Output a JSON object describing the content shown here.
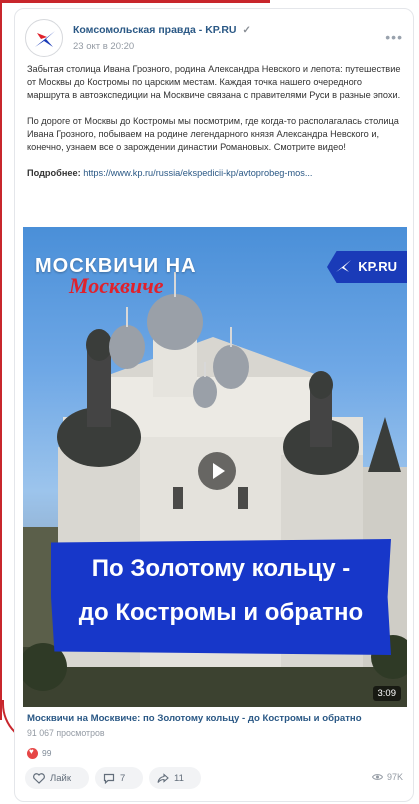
{
  "post": {
    "author": "Комсомольская правда - KP.RU",
    "verified": "✓",
    "date": "23 окт в 20:20",
    "paragraph1": "Забытая столица Ивана Грозного, родина Александра Невского и лепота: путешествие от Москвы до Костромы по царским местам. Каждая точка нашего очередного маршрута в автоэкспедиции на Москвиче связана с правителями Руси в разные эпохи.",
    "paragraph2": "По дороге от Москвы до Костромы мы посмотрим, где когда-то располагалась столица Ивана Грозного, побываем на родине легендарного князя Александра Невского и, конечно, узнаем все о зарождении династии Романовых. Смотрите видео!",
    "link_label": "Подробнее:",
    "link_url": "https://www.kp.ru/russia/ekspedicii-kp/avtoprobeg-mos..."
  },
  "video": {
    "brand_title": "МОСКВИЧИ НА",
    "brand_sub": "Москвиче",
    "kp_logo": "KP.RU",
    "banner_line1": "По Золотому кольцу -",
    "banner_line2": "до Костромы и обратно",
    "duration": "3:09",
    "title": "Москвичи на Москвиче: по Золотому кольцу - до Костромы и обратно",
    "views": "91 067 просмотров"
  },
  "reactions": {
    "count": "99"
  },
  "actions": {
    "like": "Лайк",
    "comments": "7",
    "shares": "11",
    "views": "97K"
  },
  "colors": {
    "accent": "#2a5885",
    "banner": "#1737c9",
    "brand_red": "#e0212c",
    "frame": "#c8262c"
  }
}
